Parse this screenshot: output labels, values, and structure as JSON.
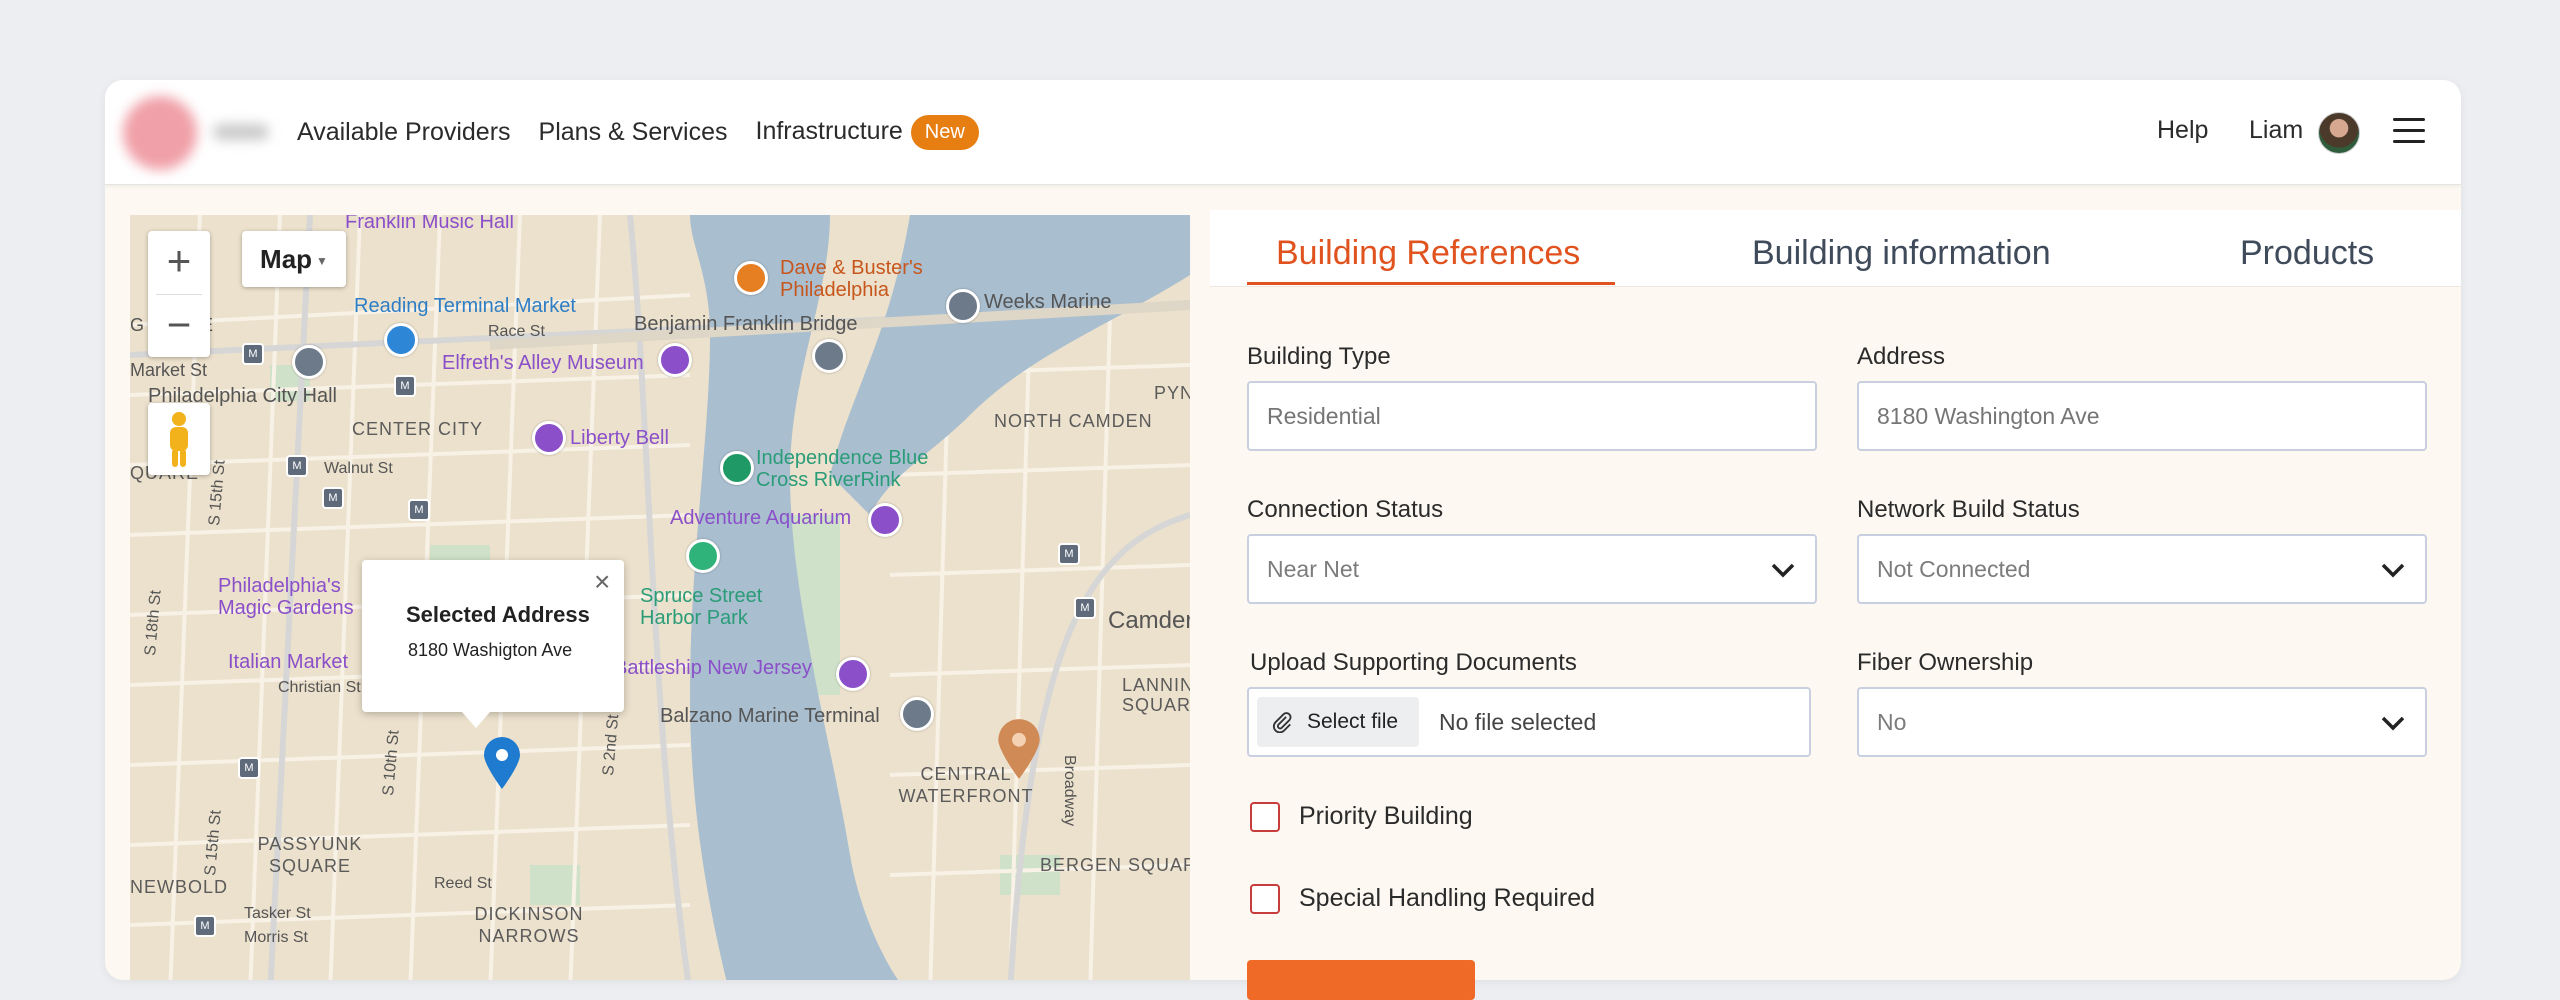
{
  "header": {
    "nav": [
      {
        "label": "Available Providers"
      },
      {
        "label": "Plans & Services"
      },
      {
        "label": "Infrastructure",
        "badge": "New"
      }
    ],
    "help": "Help",
    "user_name": "Liam"
  },
  "map": {
    "map_type": "Map",
    "zoom_in": "+",
    "zoom_out": "−",
    "popup": {
      "title": "Selected Address",
      "address": "8180 Washigton Ave",
      "close": "×"
    },
    "labels": {
      "franklin_music_hall": "Franklin Music Hall",
      "reading_terminal": "Reading Terminal Market",
      "benjamin_franklin": "Benjamin Franklin Bridge",
      "race_st": "Race St",
      "elfreths": "Elfreth's Alley Museum",
      "philadelphia_city_hall": "Philadelphia City Hall",
      "center_city": "CENTER CITY",
      "liberty_bell": "Liberty Bell",
      "independence_blue": "Independence Blue Cross RiverRink",
      "adventure_aquarium": "Adventure Aquarium",
      "spruce_street": "Spruce Street Harbor Park",
      "magic_gardens": "Philadelphia's Magic Gardens",
      "italian_market": "Italian Market",
      "christian_st": "Christian St",
      "battleship": "Battleship New Jersey",
      "balzano": "Balzano Marine Terminal",
      "dave_busters": "Dave & Buster's Philadelphia",
      "weeks_marine": "Weeks Marine",
      "pyne_poynt": "PYNE POYNT",
      "north_camden": "NORTH CAMDEN",
      "camden": "Camder",
      "lanning_square": "LANNING SQUARE",
      "central_waterfront": "CENTRAL WATERFRONT",
      "bergen_square": "BERGEN SQUAR",
      "passyunk_square": "PASSYUNK SQUARE",
      "newbold": "NEWBOLD",
      "dickinson_narrows": "DICKINSON NARROWS",
      "reed_st": "Reed St",
      "tasker_st": "Tasker St",
      "morris_st": "Morris St",
      "square_left": "QUARE",
      "square_left2": "G QUARE",
      "market_st": "Market St",
      "walnut_st": "Walnut St",
      "broadway": "Broadway",
      "s_2nd_st": "S 2nd St",
      "s_10th_st": "S 10th St",
      "s_15th_st": "S 15th St",
      "s_18th_st": "S 18th St",
      "s_15th_st_b": "S 15th St"
    }
  },
  "tabs": [
    {
      "label": "Building References"
    },
    {
      "label": "Building information"
    },
    {
      "label": "Products"
    }
  ],
  "form": {
    "building_type": {
      "label": "Building Type",
      "placeholder": "Residential"
    },
    "address": {
      "label": "Address",
      "placeholder": "8180 Washington Ave"
    },
    "connection_status": {
      "label": "Connection Status",
      "value": "Near Net"
    },
    "network_build_status": {
      "label": "Network Build Status",
      "value": "Not Connected"
    },
    "upload": {
      "label": "Upload Supporting Documents",
      "button": "Select file",
      "status": "No file selected"
    },
    "fiber_ownership": {
      "label": "Fiber Ownership",
      "value": "No"
    },
    "priority_building": {
      "label": "Priority Building",
      "checked": false
    },
    "special_handling": {
      "label": "Special Handling Required",
      "checked": false
    }
  },
  "colors": {
    "accent": "#e0531f",
    "badge": "#e67e12",
    "checkbox_border": "#c83c3c",
    "water": "#9bb3c7",
    "map_land": "#e9dcc3"
  },
  "icons": [
    "menu-icon",
    "chevron-down-icon",
    "paperclip-icon",
    "pegman-icon",
    "close-icon",
    "map-pin-icon"
  ]
}
